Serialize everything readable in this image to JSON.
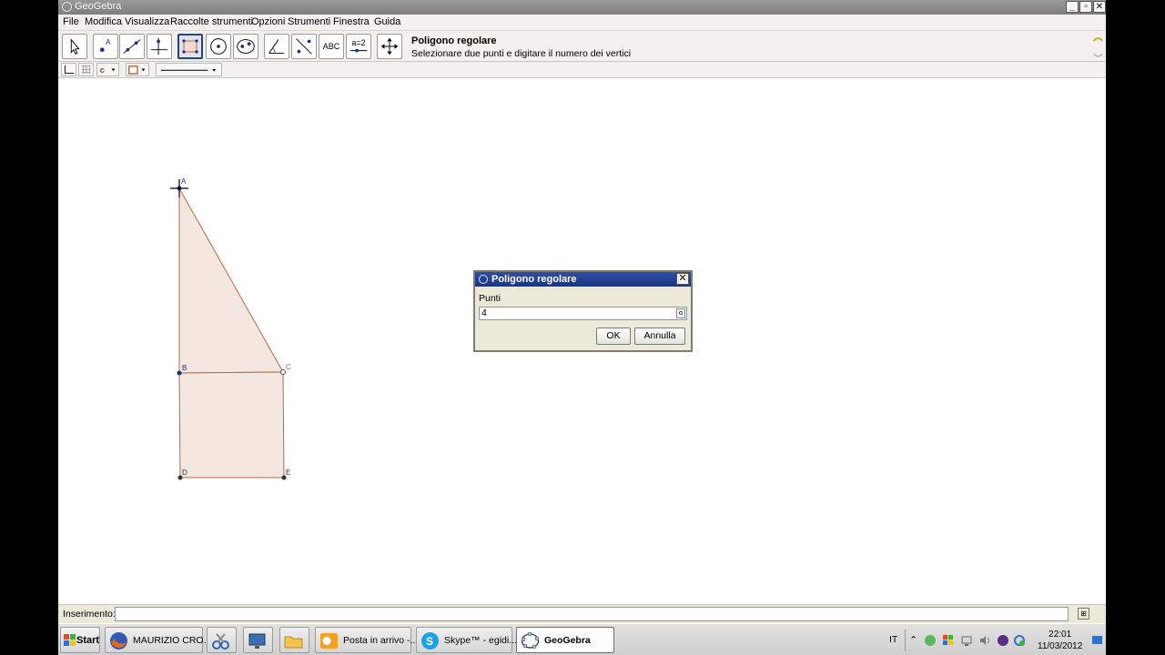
{
  "window": {
    "title": "GeoGebra"
  },
  "menu": [
    "File",
    "Modifica",
    "Visualizza",
    "Raccolte strumenti",
    "Opzioni",
    "Strumenti",
    "Finestra",
    "Guida"
  ],
  "toolbar": {
    "tools": [
      {
        "name": "move-tool",
        "icon": "pointer-icon"
      },
      {
        "name": "point-tool",
        "icon": "point-icon",
        "text": "A"
      },
      {
        "name": "line-tool",
        "icon": "line-icon"
      },
      {
        "name": "perpendicular-tool",
        "icon": "perpendicular-icon"
      },
      {
        "name": "polygon-tool",
        "icon": "polygon-icon",
        "active": true
      },
      {
        "name": "circle-tool",
        "icon": "circle-icon"
      },
      {
        "name": "conic-tool",
        "icon": "conic-icon"
      },
      {
        "name": "angle-tool",
        "icon": "angle-icon"
      },
      {
        "name": "reflect-tool",
        "icon": "reflect-icon"
      },
      {
        "name": "text-tool",
        "icon": "text-icon",
        "text": "ABC"
      },
      {
        "name": "slider-tool",
        "icon": "slider-icon",
        "text": "a=2"
      },
      {
        "name": "move-view-tool",
        "icon": "move-view-icon"
      }
    ],
    "help_title": "Poligono regolare",
    "help_desc": "Selezionare due punti e digitare il numero dei vertici"
  },
  "graphics": {
    "points": {
      "A": "A",
      "B": "B",
      "C": "C",
      "D": "D",
      "E": "E"
    },
    "colors": {
      "fill": "#f3e7e0",
      "stroke": "#b86a45",
      "point_blue": "#1f2c8a",
      "point_dark": "#333333"
    }
  },
  "dialog": {
    "title": "Poligono regolare",
    "label": "Punti",
    "value": "4",
    "ok": "OK",
    "cancel": "Annulla"
  },
  "inputbar": {
    "label": "Inserimento:"
  },
  "taskbar": {
    "start": "Start",
    "items": [
      {
        "label": "MAURIZIO CRO...",
        "icon": "firefox-icon"
      },
      {
        "label": "",
        "icon": "snipping-tool-icon"
      },
      {
        "label": "",
        "icon": "remote-desktop-icon"
      },
      {
        "label": "",
        "icon": "folder-icon"
      },
      {
        "label": "Posta in arrivo -...",
        "icon": "outlook-icon"
      },
      {
        "label": "Skype™ - egidi...",
        "icon": "skype-icon"
      },
      {
        "label": "GeoGebra",
        "icon": "geogebra-icon",
        "active": true
      }
    ],
    "lang": "IT",
    "time": "22:01",
    "date": "11/03/2012"
  }
}
